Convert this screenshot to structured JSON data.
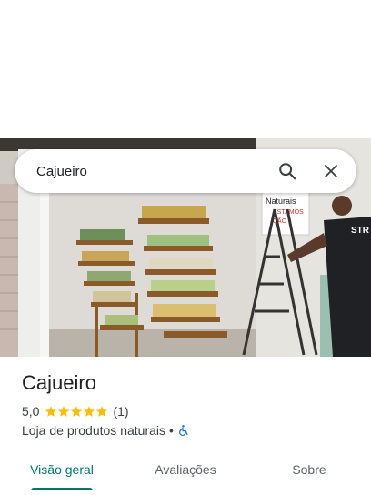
{
  "search": {
    "query": "Cajueiro",
    "search_icon": "search-icon",
    "clear_icon": "close-icon"
  },
  "place": {
    "name": "Cajueiro",
    "rating": "5,0",
    "rating_stars": 5,
    "review_count": "(1)",
    "category": "Loja de produtos naturais",
    "separator": "•",
    "accessibility_icon": "wheelchair-icon",
    "photo_sign_text": [
      "Naturais",
      "ESTAMOS",
      "ÇÃO"
    ],
    "photo_shirt_text": "STR"
  },
  "tabs": [
    {
      "label": "Visão geral",
      "active": true
    },
    {
      "label": "Avaliações",
      "active": false
    },
    {
      "label": "Sobre",
      "active": false
    }
  ],
  "colors": {
    "accent": "#00796b",
    "star": "#fbbc04",
    "accessibility": "#1a73e8"
  }
}
